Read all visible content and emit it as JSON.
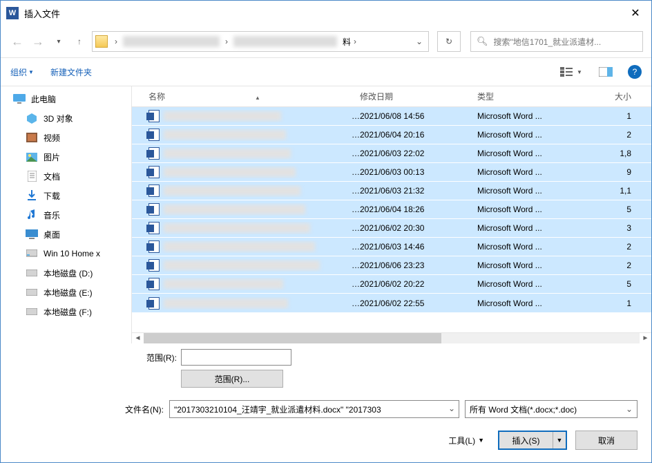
{
  "titlebar": {
    "title": "插入文件",
    "icon_letter": "W"
  },
  "nav": {
    "chevron": "›",
    "refresh": "↻",
    "search_placeholder": "搜索\"地信1701_就业派遣材..."
  },
  "toolbar": {
    "organize": "组织",
    "newfolder": "新建文件夹",
    "help": "?"
  },
  "sidebar": {
    "this_pc": "此电脑",
    "items": [
      {
        "label": "3D 对象",
        "icon": "cube"
      },
      {
        "label": "视频",
        "icon": "film"
      },
      {
        "label": "图片",
        "icon": "picture"
      },
      {
        "label": "文档",
        "icon": "doc"
      },
      {
        "label": "下载",
        "icon": "download"
      },
      {
        "label": "音乐",
        "icon": "music"
      },
      {
        "label": "桌面",
        "icon": "desktop"
      },
      {
        "label": "Win 10 Home x",
        "icon": "disk"
      },
      {
        "label": "本地磁盘 (D:)",
        "icon": "drive"
      },
      {
        "label": "本地磁盘 (E:)",
        "icon": "drive"
      },
      {
        "label": "本地磁盘 (F:)",
        "icon": "drive"
      }
    ]
  },
  "columns": {
    "name": "名称",
    "date": "修改日期",
    "type": "类型",
    "size": "大小"
  },
  "files": [
    {
      "date": "2021/06/08 14:56",
      "type": "Microsoft Word ...",
      "size": "1"
    },
    {
      "date": "2021/06/04 20:16",
      "type": "Microsoft Word ...",
      "size": "2"
    },
    {
      "date": "2021/06/03 22:02",
      "type": "Microsoft Word ...",
      "size": "1,8"
    },
    {
      "date": "2021/06/03 00:13",
      "type": "Microsoft Word ...",
      "size": "9"
    },
    {
      "date": "2021/06/03 21:32",
      "type": "Microsoft Word ...",
      "size": "1,1"
    },
    {
      "date": "2021/06/04 18:26",
      "type": "Microsoft Word ...",
      "size": "5"
    },
    {
      "date": "2021/06/02 20:30",
      "type": "Microsoft Word ...",
      "size": "3"
    },
    {
      "date": "2021/06/03 14:46",
      "type": "Microsoft Word ...",
      "size": "2"
    },
    {
      "date": "2021/06/06 23:23",
      "type": "Microsoft Word ...",
      "size": "2"
    },
    {
      "date": "2021/06/02 20:22",
      "type": "Microsoft Word ...",
      "size": "5"
    },
    {
      "date": "2021/06/02 22:55",
      "type": "Microsoft Word ...",
      "size": "1"
    }
  ],
  "bottom": {
    "range_label": "范围(R):",
    "range_btn": "范围(R)...",
    "filename_label": "文件名(N):",
    "filename_value": "\"2017303210104_汪靖宇_就业派遣材料.docx\" \"2017303",
    "filter_value": "所有 Word 文档(*.docx;*.doc)",
    "tools": "工具(L)",
    "insert": "插入(S)",
    "cancel": "取消"
  }
}
